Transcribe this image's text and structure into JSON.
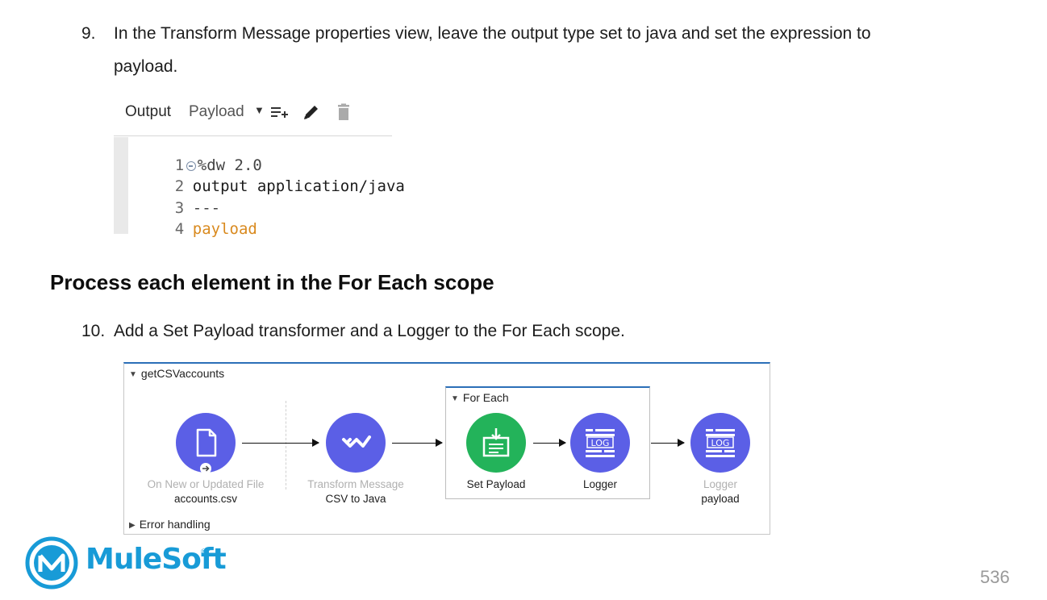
{
  "step9": {
    "number": "9.",
    "line1": "In the Transform Message properties view, leave the output type set to java and set the expression to",
    "line2": "payload."
  },
  "editor": {
    "output_label": "Output",
    "payload_label": "Payload",
    "lines": [
      {
        "num": "1",
        "text": "%dw 2.0"
      },
      {
        "num": "2",
        "text": "output application/java"
      },
      {
        "num": "3",
        "text": "---"
      },
      {
        "num": "4",
        "text": "payload"
      }
    ],
    "icons": [
      "dropdown-caret-icon",
      "add-list-icon",
      "pencil-icon",
      "trash-icon"
    ]
  },
  "section_heading": "Process each element in the For Each scope",
  "step10": {
    "number": "10.",
    "text": "Add a Set Payload transformer and a Logger to the For Each scope."
  },
  "flow": {
    "title": "getCSVaccounts",
    "foreach_title": "For Each",
    "error_handling": "Error handling",
    "nodes": {
      "file": {
        "dim": "On New or Updated File",
        "main": "accounts.csv",
        "icon": "file-icon"
      },
      "transform": {
        "dim": "Transform Message",
        "main": "CSV to Java",
        "icon": "dataweave-icon"
      },
      "set_payload": {
        "main": "Set Payload",
        "icon": "set-payload-icon"
      },
      "logger1": {
        "main": "Logger",
        "icon": "log-icon",
        "icon_text": "LOG"
      },
      "logger2": {
        "dim": "Logger",
        "main": "payload",
        "icon": "log-icon",
        "icon_text": "LOG"
      }
    },
    "colors": {
      "processor": "#5b5fe6",
      "set_payload": "#23b35a",
      "scope_border": "#2b6fb8"
    }
  },
  "brand": {
    "name": "MuleSoft",
    "trademark": "®",
    "color": "#189bd7"
  },
  "page_number": "536"
}
